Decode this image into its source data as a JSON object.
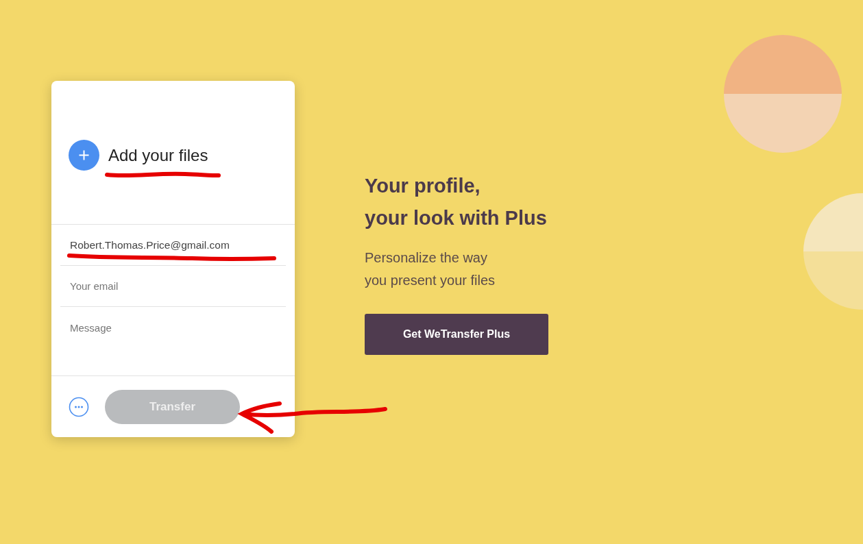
{
  "upload": {
    "label": "Add your files"
  },
  "fields": [
    {
      "kind": "input",
      "value": "Robert.Thomas.Price@gmail.com"
    },
    {
      "kind": "input",
      "placeholder": "Your email"
    },
    {
      "kind": "textarea",
      "placeholder": "Message"
    }
  ],
  "transfer_button": {
    "label": "Transfer",
    "disabled": true
  },
  "promo": {
    "heading_lines": [
      "Your profile,",
      "your look with Plus"
    ],
    "text_lines": [
      "Personalize the way",
      "you present your files"
    ],
    "button": "Get WeTransfer Plus"
  }
}
